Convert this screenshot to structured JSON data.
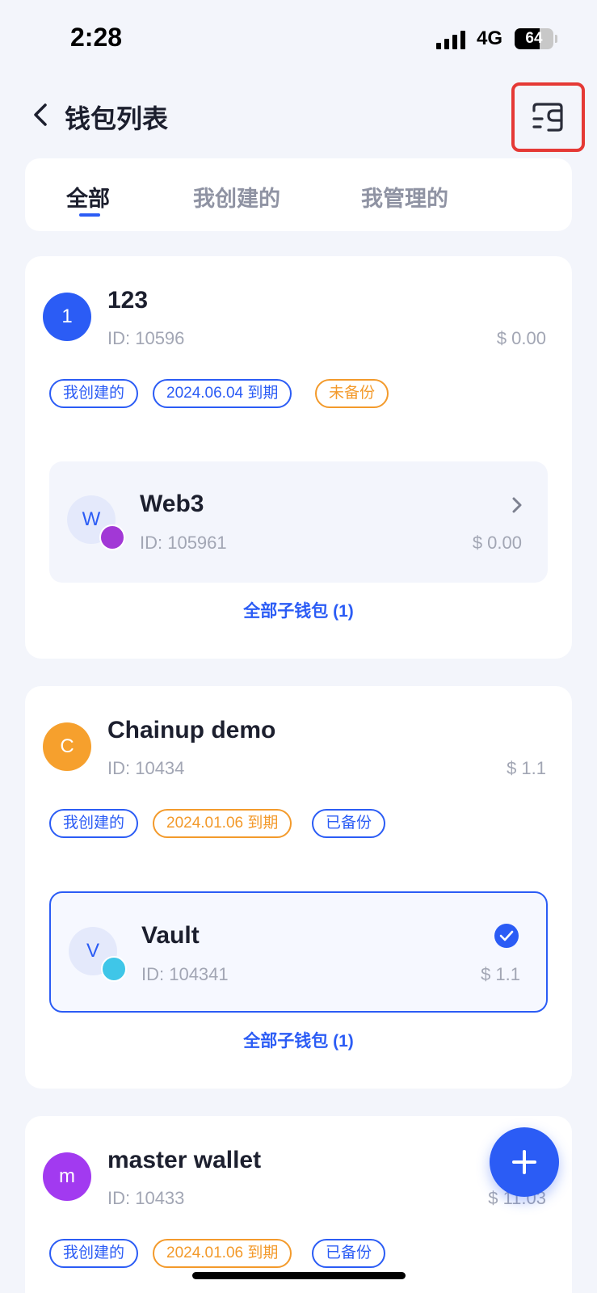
{
  "status_bar": {
    "time": "2:28",
    "network": "4G",
    "battery": "64",
    "battery_level": 0.64
  },
  "header": {
    "title": "钱包列表",
    "back_icon": "chevron-left-icon",
    "switch_icon": "wallet-switch-icon"
  },
  "tabs": [
    {
      "label": "全部",
      "active": true
    },
    {
      "label": "我创建的",
      "active": false
    },
    {
      "label": "我管理的",
      "active": false
    }
  ],
  "wallets": [
    {
      "avatar": "1",
      "avatar_color": "#2b5cf5",
      "name": "123",
      "id": "ID: 10596",
      "balance": "$ 0.00",
      "tags": [
        {
          "label": "我创建的",
          "color": "blue"
        },
        {
          "label": "2024.06.04 到期",
          "color": "blue"
        },
        {
          "label": "未备份",
          "color": "orange"
        }
      ],
      "sub_wallet": {
        "avatar": "W",
        "name": "Web3",
        "id": "ID: 105961",
        "balance": "$ 0.00",
        "selected": false,
        "badge_color": "#a238d6"
      },
      "all_sub_link": "全部子钱包 (1)"
    },
    {
      "avatar": "C",
      "avatar_color": "#f6a02d",
      "name": "Chainup demo",
      "id": "ID: 10434",
      "balance": "$ 1.1",
      "tags": [
        {
          "label": "我创建的",
          "color": "blue"
        },
        {
          "label": "2024.01.06 到期",
          "color": "orange"
        },
        {
          "label": "已备份",
          "color": "blue"
        }
      ],
      "sub_wallet": {
        "avatar": "V",
        "name": "Vault",
        "id": "ID: 104341",
        "balance": "$ 1.1",
        "selected": true,
        "badge_color": "#3fc6e8"
      },
      "all_sub_link": "全部子钱包 (1)"
    },
    {
      "avatar": "m",
      "avatar_color": "#a23af0",
      "name": "master wallet",
      "id": "ID: 10433",
      "balance": "$ 11.03",
      "tags": [
        {
          "label": "我创建的",
          "color": "blue"
        },
        {
          "label": "2024.01.06 到期",
          "color": "orange"
        },
        {
          "label": "已备份",
          "color": "blue"
        }
      ]
    }
  ],
  "fab": {
    "icon": "plus-icon"
  }
}
